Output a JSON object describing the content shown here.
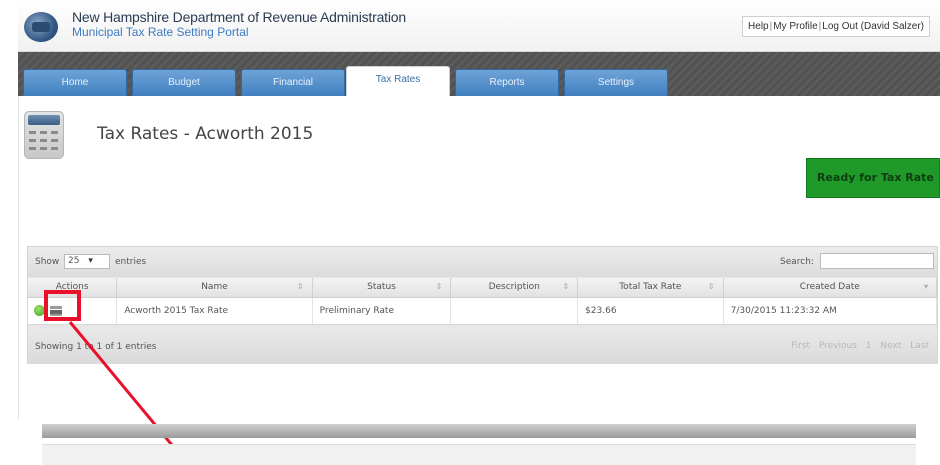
{
  "header": {
    "org_title": "New Hampshire Department of Revenue Administration",
    "portal_title": "Municipal Tax Rate Setting Portal",
    "help_link": "Help",
    "profile_link": "My Profile",
    "logout_link": "Log Out (David Salzer)"
  },
  "nav": {
    "tabs": [
      {
        "label": "Home"
      },
      {
        "label": "Budget"
      },
      {
        "label": "Financial"
      },
      {
        "label": "Tax Rates"
      },
      {
        "label": "Reports"
      },
      {
        "label": "Settings"
      }
    ],
    "active_tab": "Tax Rates"
  },
  "page": {
    "title": "Tax Rates - Acworth 2015",
    "ready_badge": "Ready for Tax Rate"
  },
  "table": {
    "show_label": "Show",
    "entries_value": "25",
    "entries_label": "entries",
    "search_label": "Search:",
    "search_value": "",
    "columns": [
      "Actions",
      "Name",
      "Status",
      "Description",
      "Total Tax Rate",
      "Created Date"
    ],
    "rows": [
      {
        "name": "Acworth 2015 Tax Rate",
        "status": "Preliminary Rate",
        "description": "",
        "total_tax_rate": "$23.66",
        "created_date": "7/30/2015 11:23:32 AM"
      }
    ],
    "showing_text": "Showing 1 to 1 of 1 entries",
    "pager": {
      "first": "First",
      "previous": "Previous",
      "page": "1",
      "next": "Next",
      "last": "Last"
    }
  },
  "colors": {
    "tab_blue": "#4a88c7",
    "ready_green": "#1f9a2a",
    "highlight_red": "#e8102a"
  },
  "icons": {
    "logo": "state-seal-icon",
    "page_icon": "calculator-icon",
    "row_action_1": "add-icon",
    "row_action_2": "print-icon"
  }
}
